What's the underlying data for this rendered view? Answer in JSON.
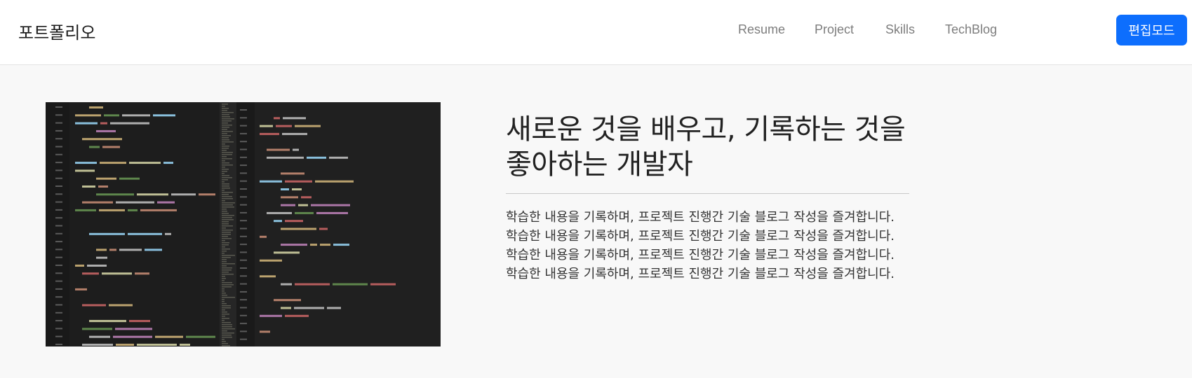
{
  "navbar": {
    "brand": "포트폴리오",
    "links": [
      "Resume",
      "Project",
      "Skills",
      "TechBlog"
    ],
    "edit_button": "편집모드"
  },
  "hero": {
    "headline": "새로운 것을 배우고, 기록하는 것을 좋아하는 개발자",
    "description": "학습한 내용을 기록하며, 프로젝트 진행간 기술 블로그 작성을 즐겨합니다. 학습한 내용을 기록하며, 프로젝트 진행간 기술 블로그 작성을 즐겨합니다. 학습한 내용을 기록하며, 프로젝트 진행간 기술 블로그 작성을 즐겨합니다. 학습한 내용을 기록하며, 프로젝트 진행간 기술 블로그 작성을 즐겨합니다.",
    "image": "code-screenshot-image"
  },
  "colors": {
    "primary": "#0d6efd",
    "background": "#f8f8f8",
    "navbar": "#ffffff"
  }
}
